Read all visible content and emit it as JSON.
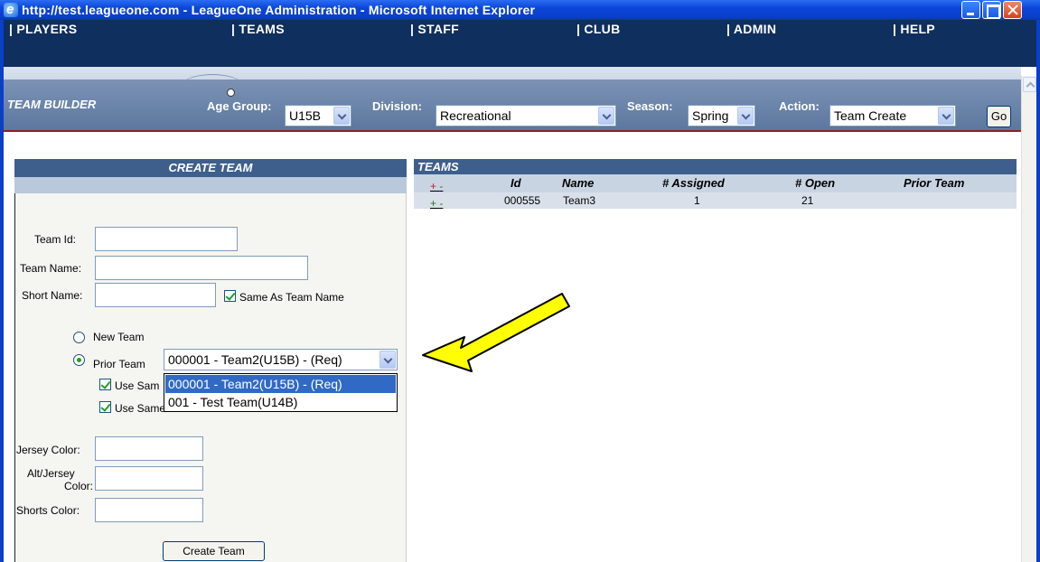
{
  "window": {
    "title": "http://test.leagueone.com - LeagueOne Administration - Microsoft Internet Explorer"
  },
  "nav": {
    "items": [
      "| PLAYERS",
      "| TEAMS",
      "| STAFF",
      "| CLUB",
      "| ADMIN",
      "| HELP"
    ]
  },
  "toolbar": {
    "title": "TEAM BUILDER",
    "age_group_label": "Age Group:",
    "age_group_value": "U15B",
    "division_label": "Division:",
    "division_value": "Recreational",
    "season_label": "Season:",
    "season_value": "Spring",
    "action_label": "Action:",
    "action_value": "Team Create",
    "go_label": "Go"
  },
  "create_team": {
    "header": "CREATE TEAM",
    "team_id_label": "Team Id:",
    "team_name_label": "Team Name:",
    "short_name_label": "Short Name:",
    "same_as_team_name_label": "Same As Team Name",
    "same_as_team_name_checked": true,
    "new_team_label": "New Team",
    "prior_team_label": "Prior Team",
    "prior_team_selected": true,
    "prior_team_value": "000001 - Team2(U15B) - (Req)",
    "prior_team_options": [
      "000001 - Team2(U15B) - (Req)",
      "001 - Test Team(U14B)"
    ],
    "use_same_1_label": "Use Sam",
    "use_same_2_label": "Use Same Colors?",
    "jersey_color_label": "Jersey Color:",
    "alt_jersey_color_label_1": "Alt/Jersey",
    "alt_jersey_color_label_2": "Color:",
    "shorts_color_label": "Shorts Color:",
    "create_button_label": "Create Team"
  },
  "teams": {
    "header": "TEAMS",
    "columns": [
      "Id",
      "Name",
      "# Assigned",
      "# Open",
      "Prior Team"
    ],
    "header_toggle": {
      "plus": "+",
      "minus": "-"
    },
    "rows": [
      {
        "toggle_plus": "+",
        "toggle_minus": "-",
        "id": "000555",
        "name": "Team3",
        "assigned": "1",
        "open": "21",
        "prior": ""
      }
    ]
  },
  "colors": {
    "nav_bg": "#0f2f5e",
    "panel_header": "#3e5f8c",
    "annotation_arrow": "#ffff00"
  }
}
